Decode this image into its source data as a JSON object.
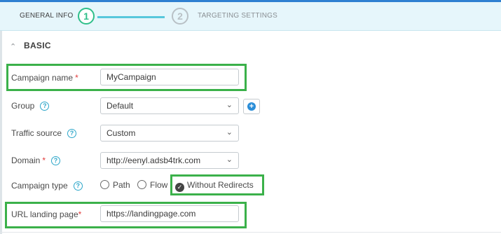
{
  "steps": {
    "step1": {
      "number": "1",
      "label": "GENERAL INFO"
    },
    "step2": {
      "number": "2",
      "label": "TARGETING SETTINGS"
    }
  },
  "section": {
    "title": "BASIC",
    "caret_icon": "chevron-up-icon"
  },
  "form": {
    "campaign_name": {
      "label": "Campaign name",
      "required": "*",
      "value": "MyCampaign"
    },
    "group": {
      "label": "Group",
      "help": "?",
      "value": "Default",
      "add_icon": "+"
    },
    "traffic_source": {
      "label": "Traffic source",
      "help": "?",
      "value": "Custom"
    },
    "domain": {
      "label": "Domain",
      "required": "*",
      "help": "?",
      "value": "http://eenyl.adsb4trk.com"
    },
    "campaign_type": {
      "label": "Campaign type",
      "help": "?",
      "options": [
        "Path",
        "Flow",
        "Without Redirects"
      ],
      "selected": "Without Redirects"
    },
    "url_landing_page": {
      "label": "URL landing page",
      "required": "*",
      "value": "https://landingpage.com"
    }
  },
  "colors": {
    "highlight": "#3bb14a",
    "step_active": "#2fbf8a",
    "accent": "#2ca6c9",
    "required": "#e23b3b"
  }
}
